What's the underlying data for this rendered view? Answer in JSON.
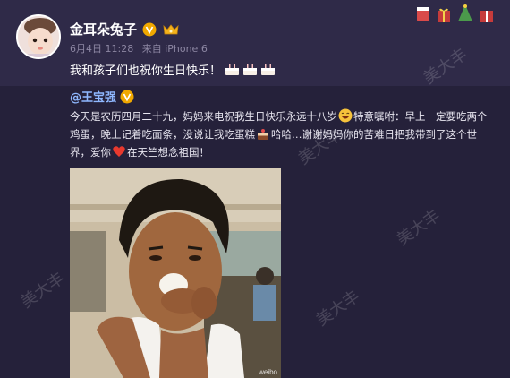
{
  "post": {
    "author": "金耳朵兔子",
    "date": "6月4日 11:28",
    "source": "来自 iPhone 6",
    "text": "我和孩子们也祝你生日快乐！"
  },
  "repost": {
    "author": "@王宝强",
    "text_1": "今天是农历四月二十九，妈妈来电祝我生日快乐永远十八岁",
    "text_2": "特意嘱咐：早上一定要吃两个鸡蛋，晚上记着吃面条，没说让我吃蛋糕",
    "text_3": "哈哈…谢谢妈妈你的苦难日把我带到了这个世界，爱你",
    "text_4": "在天竺想念祖国！"
  },
  "photo_watermark": "weibo",
  "watermark_text": "美大丰",
  "colors": {
    "page_bg": "#2a2540",
    "repost_name": "#8fb8ff",
    "verified_badge": "#f0a800"
  },
  "icons": [
    "verified-badge-icon",
    "vip-badge-icon",
    "cake-icon",
    "laughing-emoji-icon",
    "cake-emoji-icon",
    "heart-emoji-icon",
    "festive-decoration-icon"
  ]
}
